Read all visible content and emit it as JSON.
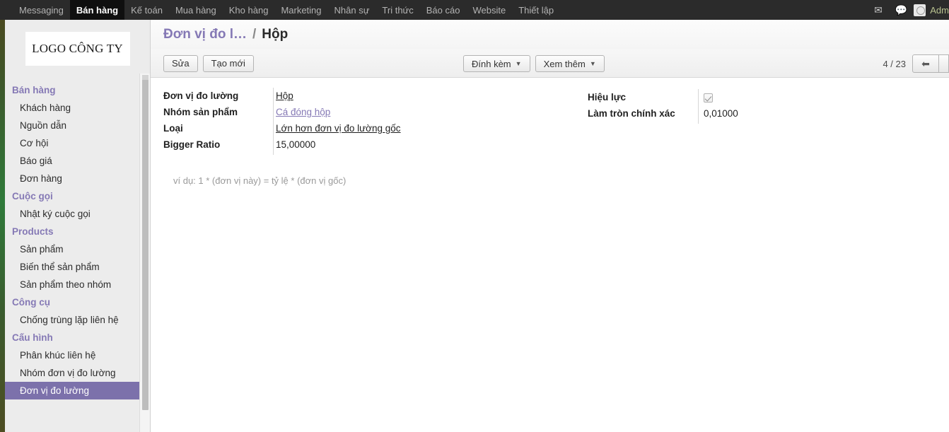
{
  "topbar": {
    "items": [
      {
        "label": "Messaging",
        "active": false
      },
      {
        "label": "Bán hàng",
        "active": true
      },
      {
        "label": "Kế toán",
        "active": false
      },
      {
        "label": "Mua hàng",
        "active": false
      },
      {
        "label": "Kho hàng",
        "active": false
      },
      {
        "label": "Marketing",
        "active": false
      },
      {
        "label": "Nhân sự",
        "active": false
      },
      {
        "label": "Tri thức",
        "active": false
      },
      {
        "label": "Báo cáo",
        "active": false
      },
      {
        "label": "Website",
        "active": false
      },
      {
        "label": "Thiết lập",
        "active": false
      }
    ],
    "mail_icon": "envelope-icon",
    "chat_icon": "chat-bubble-icon",
    "avatar_icon": "user-avatar",
    "username": "Adm"
  },
  "sidebar": {
    "logo_text": "LOGO CÔNG TY",
    "groups": [
      {
        "heading": "Bán hàng",
        "items": [
          {
            "label": "Khách hàng",
            "selected": false
          },
          {
            "label": "Nguồn dẫn",
            "selected": false
          },
          {
            "label": "Cơ hội",
            "selected": false
          },
          {
            "label": "Báo giá",
            "selected": false
          },
          {
            "label": "Đơn hàng",
            "selected": false
          }
        ]
      },
      {
        "heading": "Cuộc gọi",
        "items": [
          {
            "label": "Nhật ký cuộc gọi",
            "selected": false
          }
        ]
      },
      {
        "heading": "Products",
        "items": [
          {
            "label": "Sản phẩm",
            "selected": false
          },
          {
            "label": "Biến thể sản phẩm",
            "selected": false
          },
          {
            "label": "Sản phẩm theo nhóm",
            "selected": false
          }
        ]
      },
      {
        "heading": "Công cụ",
        "items": [
          {
            "label": "Chống trùng lặp liên hệ",
            "selected": false
          }
        ]
      },
      {
        "heading": "Cấu hình",
        "items": [
          {
            "label": "Phân khúc liên hệ",
            "selected": false
          },
          {
            "label": "Nhóm đơn vị đo lường",
            "selected": false
          },
          {
            "label": "Đơn vị đo lường",
            "selected": true
          }
        ]
      }
    ]
  },
  "breadcrumb": {
    "parent": "Đơn vị đo l…",
    "separator": "/",
    "current": "Hộp"
  },
  "toolbar": {
    "edit_label": "Sửa",
    "create_label": "Tạo mới",
    "attach_label": "Đính kèm",
    "more_label": "Xem thêm",
    "caret": "▼",
    "pager_count": "4 / 23",
    "pager_prev_icon": "arrow-left-icon"
  },
  "form": {
    "left": [
      {
        "label": "Đơn vị đo lường",
        "value": "Hộp",
        "kind": "text",
        "annotated": true
      },
      {
        "label": "Nhóm sản phẩm",
        "value": "Cá đóng hộp",
        "kind": "link",
        "annotated": true
      },
      {
        "label": "Loại",
        "value": "Lớn hơn đơn vị đo lường gốc",
        "kind": "text",
        "annotated": true
      },
      {
        "label": "Bigger Ratio",
        "value": "15,00000",
        "kind": "plain",
        "annotated": true
      }
    ],
    "right": [
      {
        "label": "Hiệu lực",
        "value": "",
        "kind": "checkbox",
        "checked": true
      },
      {
        "label": "Làm tròn chính xác",
        "value": "0,01000",
        "kind": "plain"
      }
    ],
    "helper_text": "ví dụ: 1 * (đơn vị này) = tỷ lệ * (đơn vị gốc)"
  },
  "colors": {
    "accent_purple": "#8579b5",
    "selected_purple": "#7c71ab",
    "annotation_red": "#ef2020",
    "topbar_dark": "#2b2b2b"
  }
}
